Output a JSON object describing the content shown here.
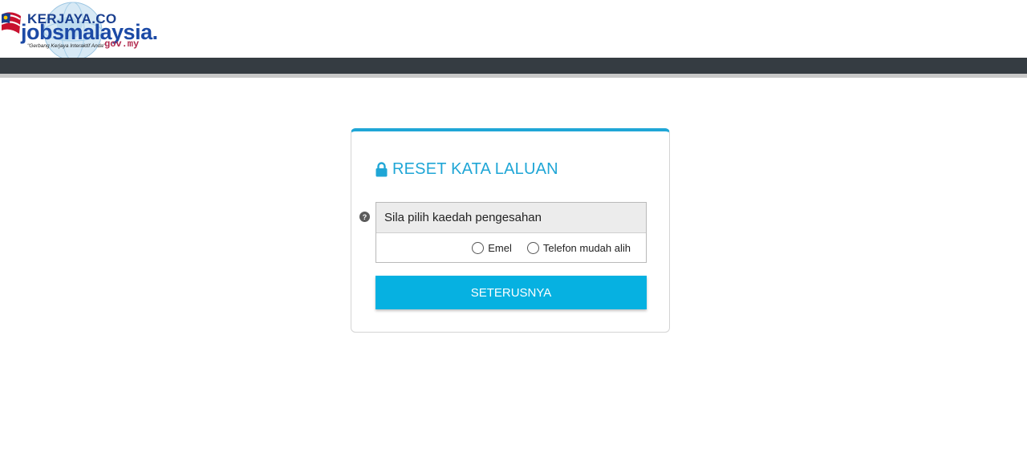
{
  "brand": {
    "name_top": "KERJAYA.CO",
    "name_main": "jobsmalaysia.",
    "domain": "gov.my",
    "tagline": "\"Gerbang Kerjaya Interaktif Anda\""
  },
  "card": {
    "title": "RESET KATA LALUAN",
    "method_prompt": "Sila pilih kaedah pengesahan",
    "options": [
      {
        "label": "Emel",
        "selected": false
      },
      {
        "label": "Telefon mudah alih",
        "selected": false
      }
    ],
    "next_label": "SETERUSNYA"
  },
  "colors": {
    "accent": "#1fa6d6",
    "button": "#06b1e1",
    "topbar": "#353c42"
  },
  "icons": {
    "title_icon": "lock-icon",
    "help_icon": "question-circle-icon"
  }
}
